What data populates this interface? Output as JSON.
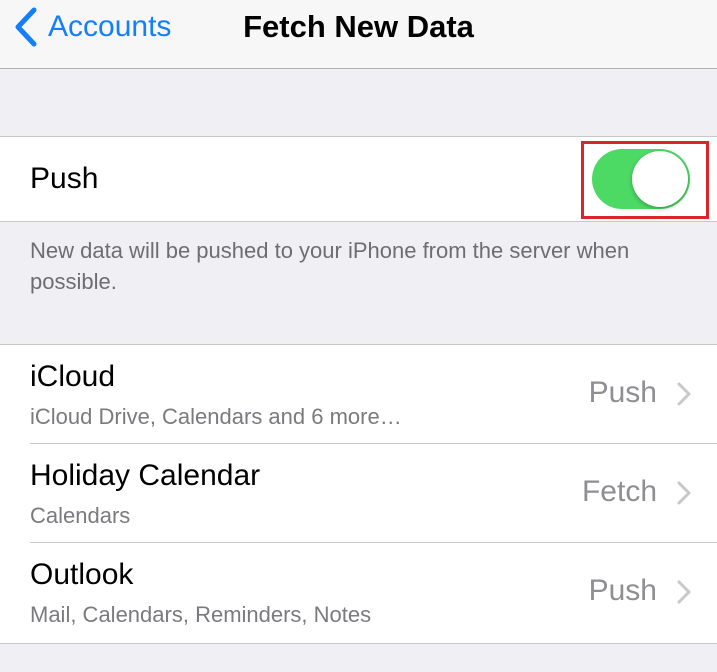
{
  "navbar": {
    "back_label": "Accounts",
    "title": "Fetch New Data"
  },
  "push": {
    "label": "Push",
    "enabled": true,
    "footer": "New data will be pushed to your iPhone from the server when possible."
  },
  "accounts": [
    {
      "name": "iCloud",
      "detail": "iCloud Drive, Calendars and 6 more…",
      "mode": "Push"
    },
    {
      "name": "Holiday Calendar",
      "detail": "Calendars",
      "mode": "Fetch"
    },
    {
      "name": "Outlook",
      "detail": "Mail, Calendars, Reminders, Notes",
      "mode": "Push"
    }
  ],
  "colors": {
    "accent": "#147efb",
    "toggle_on": "#4cd964",
    "highlight": "#d9252b",
    "background": "#efeff4"
  },
  "icons": {
    "back": "chevron-left-icon",
    "disclosure": "chevron-right-icon"
  }
}
